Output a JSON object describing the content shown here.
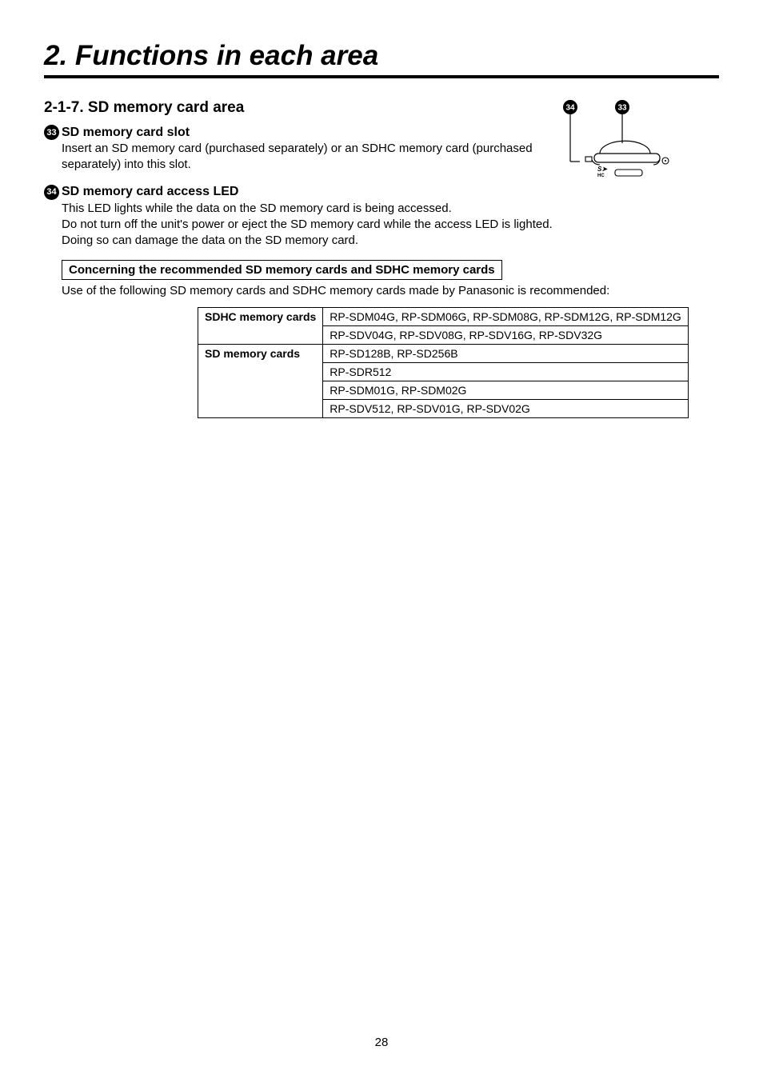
{
  "main_heading": "2. Functions in each area",
  "section": {
    "number_title": "2-1-7.  SD memory card area",
    "item33": {
      "num": "33",
      "title": "SD memory card slot",
      "body": "Insert an SD memory card (purchased separately) or an SDHC memory card (purchased separately) into this slot."
    },
    "item34": {
      "num": "34",
      "title": "SD memory card access LED",
      "body_line1": "This LED lights while the data on the SD memory card is being accessed.",
      "body_line2": "Do not turn off the unit's power or eject the SD memory card while the access LED is lighted.",
      "body_line3": "Doing so can damage the data on the SD memory card."
    },
    "note_box": "Concerning the recommended SD memory cards and SDHC memory cards",
    "note_text": "Use of the following SD memory cards and SDHC memory cards made by Panasonic is recommended:",
    "table": {
      "header_sdhc": "SDHC memory cards",
      "header_sd": "SD memory cards",
      "sdhc_row1": "RP-SDM04G, RP-SDM06G, RP-SDM08G, RP-SDM12G, RP-SDM12G",
      "sdhc_row2": "RP-SDV04G, RP-SDV08G, RP-SDV16G, RP-SDV32G",
      "sd_row1": "RP-SD128B, RP-SD256B",
      "sd_row2": "RP-SDR512",
      "sd_row3": "RP-SDM01G, RP-SDM02G",
      "sd_row4": "RP-SDV512, RP-SDV01G, RP-SDV02G"
    },
    "diagram": {
      "label_left": "34",
      "label_right": "33"
    }
  },
  "page_number": "28"
}
